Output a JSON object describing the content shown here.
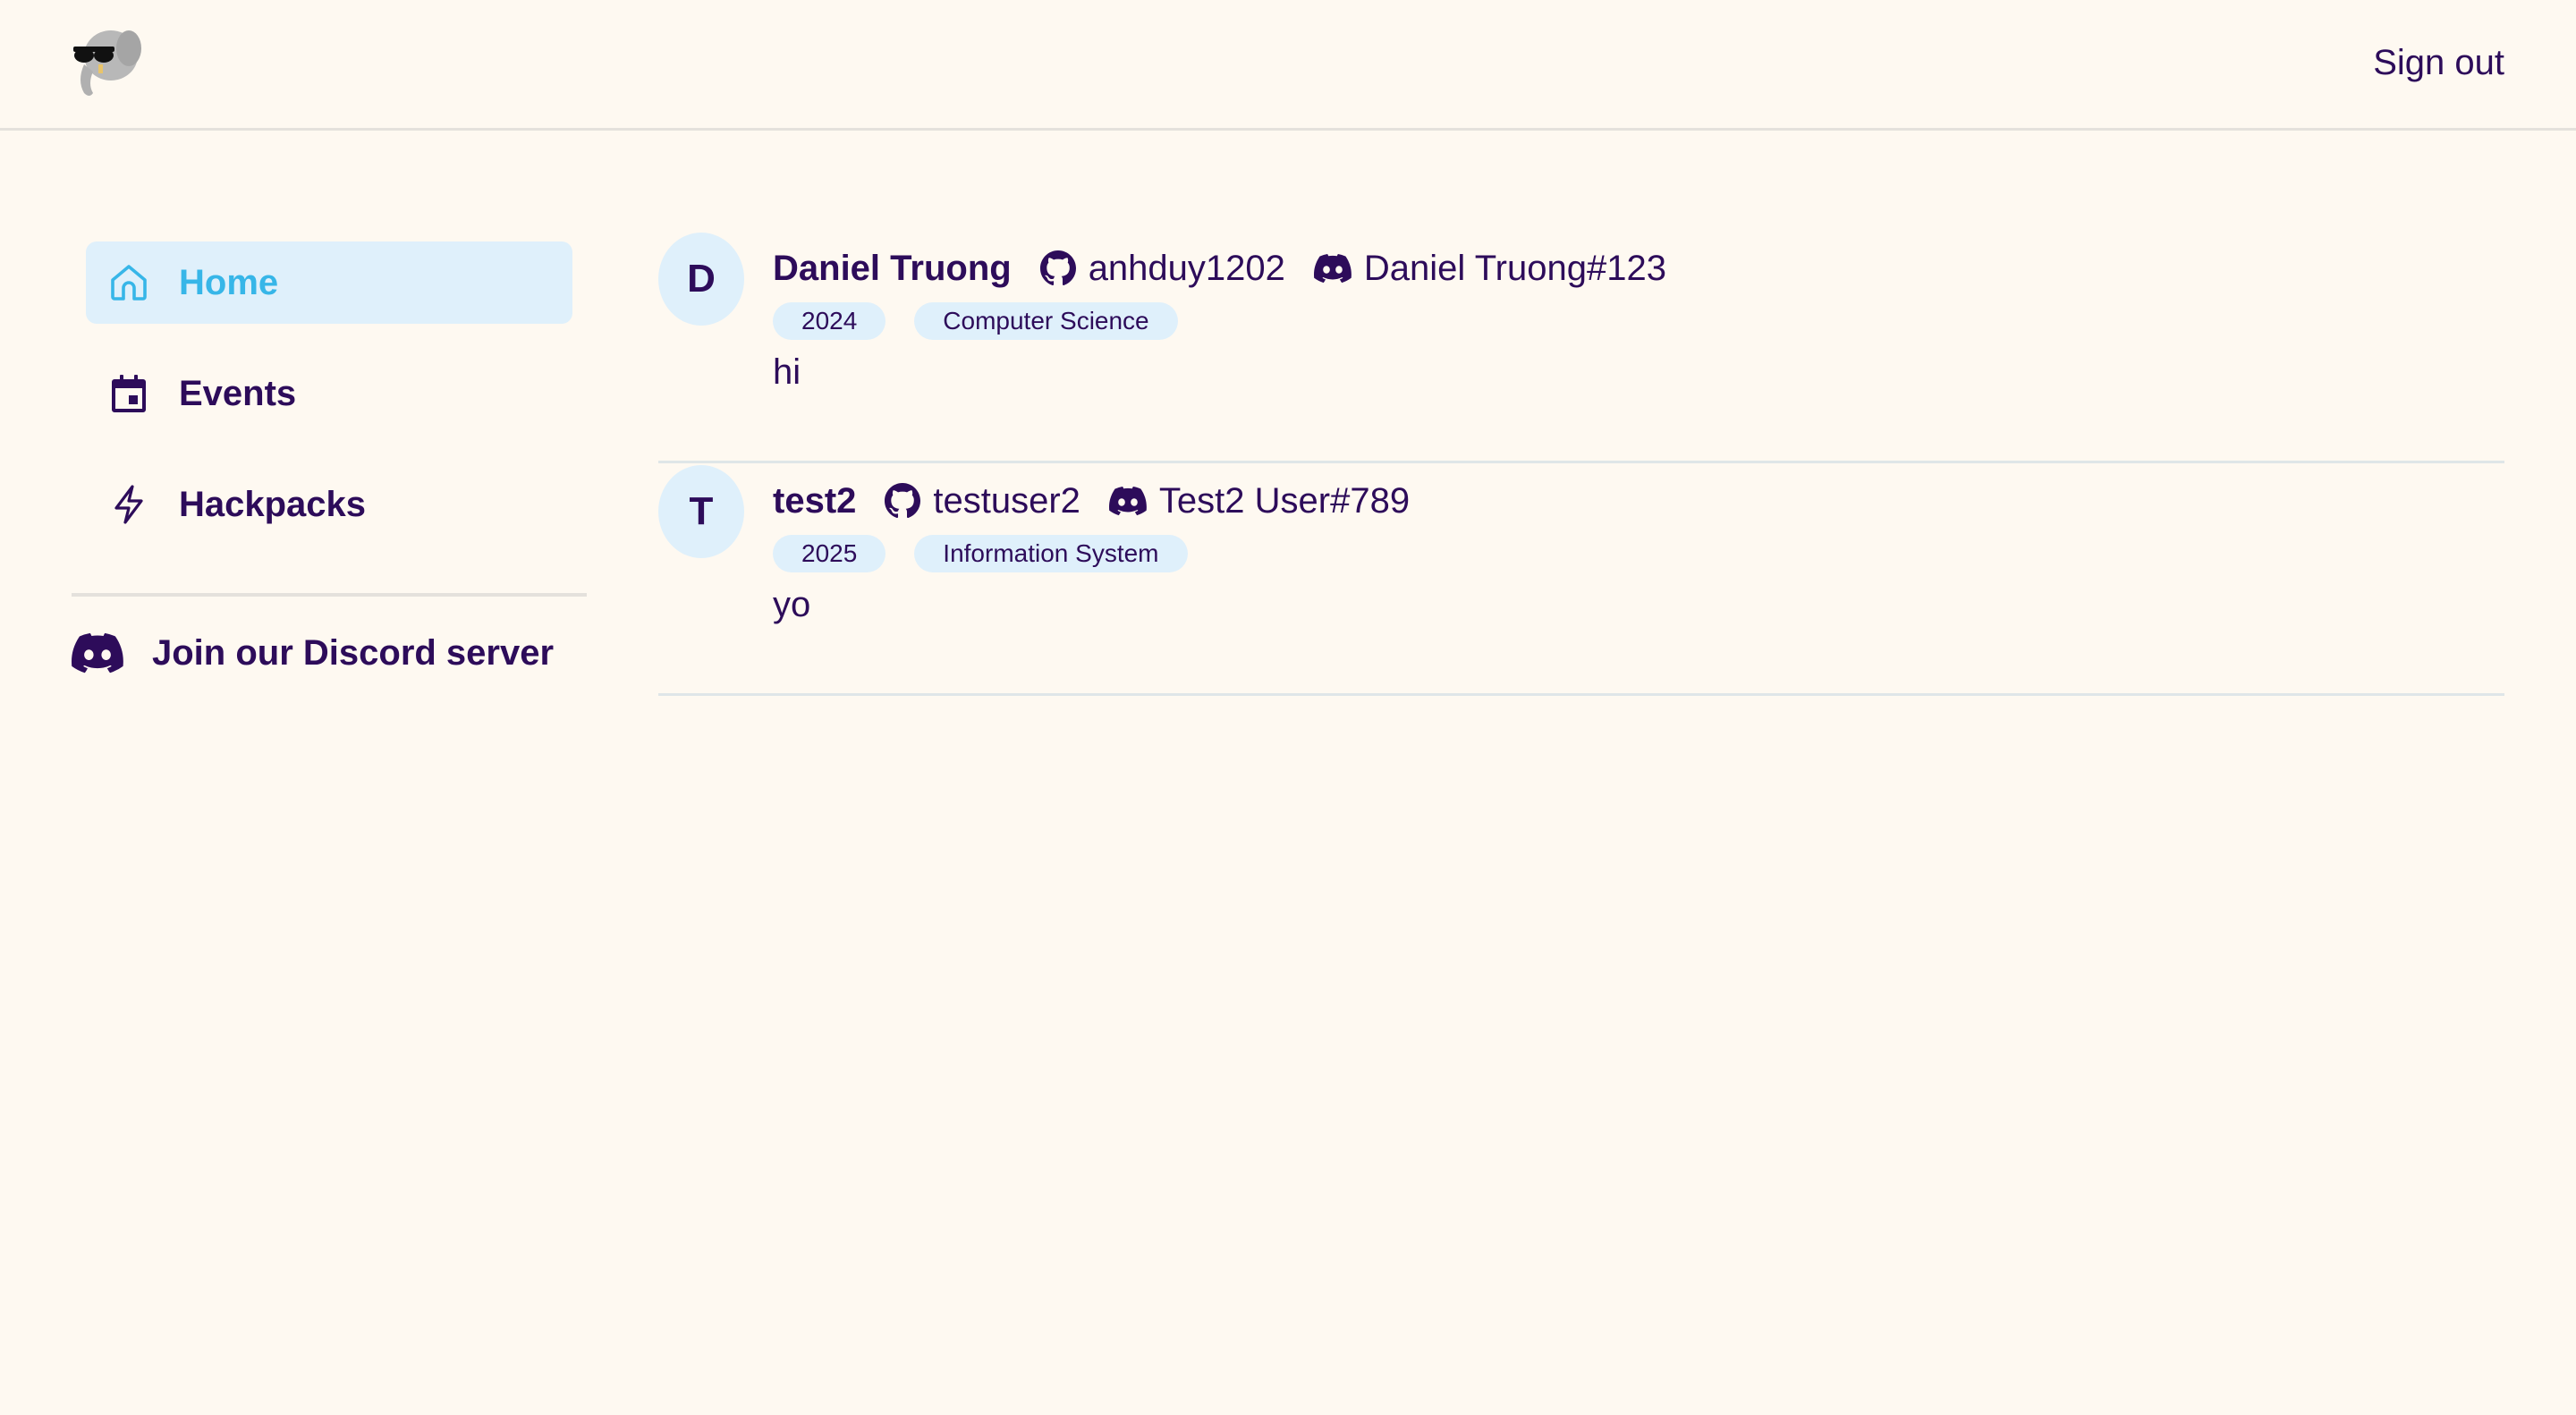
{
  "header": {
    "logo_alt": "elephant with sunglasses logo",
    "signout_label": "Sign out"
  },
  "sidebar": {
    "items": [
      {
        "label": "Home",
        "icon": "home-icon",
        "active": true
      },
      {
        "label": "Events",
        "icon": "calendar-icon",
        "active": false
      },
      {
        "label": "Hackpacks",
        "icon": "lightning-icon",
        "active": false
      }
    ],
    "discord_label": "Join our Discord server"
  },
  "feed": {
    "posts": [
      {
        "avatar_initial": "D",
        "name": "Daniel Truong",
        "github": "anhduy1202",
        "discord": "Daniel Truong#123",
        "tags": [
          "2024",
          "Computer Science"
        ],
        "body": "hi"
      },
      {
        "avatar_initial": "T",
        "name": "test2",
        "github": "testuser2",
        "discord": "Test2 User#789",
        "tags": [
          "2025",
          "Information System"
        ],
        "body": "yo"
      }
    ]
  },
  "colors": {
    "background": "#fef9f1",
    "text": "#2d0c5a",
    "accent": "#37b6e8",
    "accent_bg": "#dff0fb",
    "divider": "#e4e1dc"
  }
}
